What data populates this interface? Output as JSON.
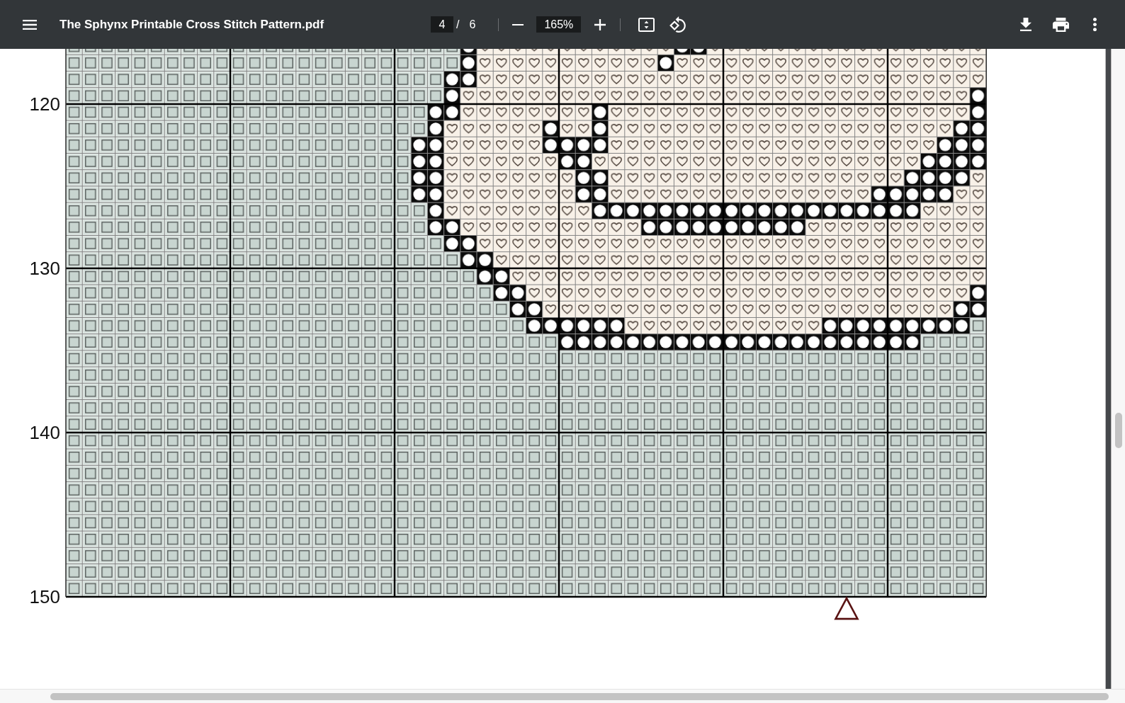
{
  "toolbar": {
    "title": "The Sphynx Printable Cross Stitch Pattern.pdf",
    "page_number": "4",
    "page_separator": "/",
    "page_count": "6",
    "zoom": "165%"
  },
  "pattern": {
    "row_numbers": [
      "120",
      "130",
      "140",
      "150"
    ]
  }
}
